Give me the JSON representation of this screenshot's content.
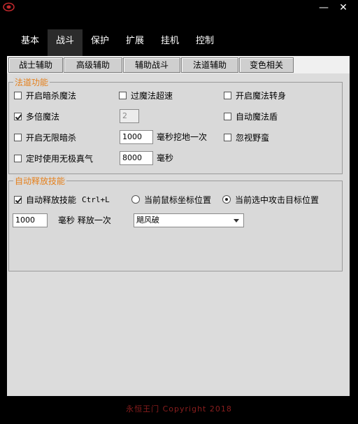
{
  "window": {
    "minimize": "—",
    "close": "✕"
  },
  "top_tabs": [
    "基本",
    "战斗",
    "保护",
    "扩展",
    "挂机",
    "控制"
  ],
  "active_top_tab": 1,
  "sub_tabs": [
    "战士辅助",
    "高级辅助",
    "辅助战斗",
    "法道辅助",
    "变色相关"
  ],
  "section1": {
    "title": "法道功能",
    "open_dark_kill": "开启暗杀魔法",
    "over_magic_speed": "过魔法超速",
    "open_magic_turn": "开启魔法转身",
    "multi_magic": "多倍魔法",
    "multi_value": "2",
    "auto_shield": "自动魔法盾",
    "unlimited_dark": "开启无限暗杀",
    "dig_value": "1000",
    "dig_label": "毫秒挖地一次",
    "ignore_brutal": "忽视野蛮",
    "timed_qi": "定时使用无极真气",
    "qi_value": "8000",
    "qi_unit": "毫秒"
  },
  "section2": {
    "title": "自动释放技能",
    "auto_release": "自动释放技能",
    "shortcut": "Ctrl+L",
    "radio_mouse": "当前鼠标坐标位置",
    "radio_target": "当前选中攻击目标位置",
    "interval_value": "1000",
    "interval_label": "毫秒 释放一次",
    "skill_selected": "飓风破"
  },
  "footer": "永恒王门   Copyright 2018"
}
